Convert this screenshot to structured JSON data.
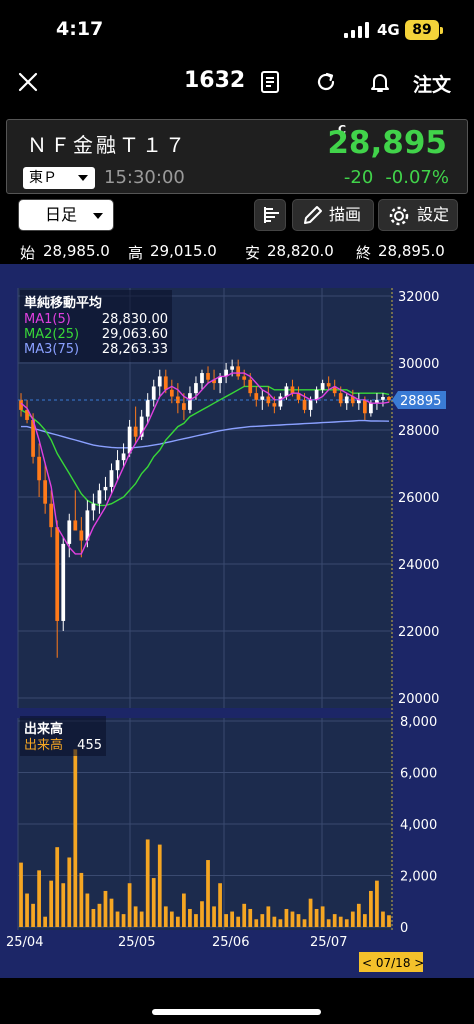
{
  "status": {
    "time": "4:17",
    "network": "4G",
    "battery": "89"
  },
  "nav": {
    "code": "1632",
    "order_label": "注文"
  },
  "quote": {
    "name": "ＮＦ金融Ｔ１７",
    "market": "東Ｐ",
    "time": "15:30:00",
    "flag": "C",
    "price": "28,895",
    "change": "-20",
    "change_pct": "-0.07%"
  },
  "toolbar": {
    "period": "日足",
    "draw": "描画",
    "settings": "設定"
  },
  "ohlc": {
    "open_label": "始",
    "open": "28,985.0",
    "high_label": "高",
    "high": "29,015.0",
    "low_label": "安",
    "low": "28,820.0",
    "close_label": "終",
    "close": "28,895.0"
  },
  "ma_legend": {
    "title": "単純移動平均",
    "rows": [
      {
        "label": "MA1(5)",
        "value": "28,830.00",
        "color": "#e040e0"
      },
      {
        "label": "MA2(25)",
        "value": "29,063.60",
        "color": "#38d838"
      },
      {
        "label": "MA3(75)",
        "value": "28,263.33",
        "color": "#8aa0ff"
      }
    ]
  },
  "volume_legend": {
    "title": "出来高",
    "label": "出来高",
    "value": "455"
  },
  "colors": {
    "up": "#ffffff",
    "down": "#ff7a1a",
    "bg": "#1c2667",
    "price_tag": "#3a7bd5",
    "volume": "#f5a623"
  },
  "chart_data": {
    "type": "candlestick",
    "price_axis": {
      "ticks": [
        "32000",
        "30000",
        "28000",
        "26000",
        "24000",
        "22000",
        "20000"
      ],
      "ylim": [
        20000,
        32000
      ]
    },
    "volume_axis": {
      "ticks": [
        "8,000",
        "6,000",
        "4,000",
        "2,000",
        "0"
      ],
      "ylim": [
        0,
        8000
      ]
    },
    "x_ticks": [
      "25/04",
      "25/05",
      "25/06",
      "25/07"
    ],
    "current_price_tag": "28895",
    "cursor_date": "< 07/18 >",
    "candles": [
      [
        28900,
        29100,
        28400,
        28600
      ],
      [
        28600,
        28900,
        28200,
        28300
      ],
      [
        28300,
        28500,
        27000,
        27200
      ],
      [
        27200,
        27600,
        26000,
        26500
      ],
      [
        26500,
        27000,
        25500,
        25800
      ],
      [
        25800,
        26200,
        24800,
        25100
      ],
      [
        25100,
        25300,
        21200,
        22300
      ],
      [
        22300,
        24800,
        22000,
        24600
      ],
      [
        24600,
        25500,
        24200,
        25300
      ],
      [
        25300,
        26200,
        25100,
        25000
      ],
      [
        25000,
        25400,
        24200,
        24700
      ],
      [
        24700,
        25900,
        24500,
        25600
      ],
      [
        25600,
        26100,
        25300,
        25800
      ],
      [
        25800,
        26400,
        25500,
        26200
      ],
      [
        26200,
        26600,
        25900,
        26300
      ],
      [
        26300,
        27000,
        26100,
        26800
      ],
      [
        26800,
        27400,
        26500,
        27100
      ],
      [
        27100,
        27600,
        26900,
        27300
      ],
      [
        27300,
        28300,
        27200,
        28100
      ],
      [
        28100,
        28700,
        27600,
        27800
      ],
      [
        27800,
        28600,
        27700,
        28400
      ],
      [
        28400,
        29100,
        28200,
        28900
      ],
      [
        28900,
        29500,
        28700,
        29300
      ],
      [
        29300,
        29800,
        29000,
        29600
      ],
      [
        29600,
        29800,
        29100,
        29200
      ],
      [
        29200,
        29500,
        28800,
        29000
      ],
      [
        29000,
        29400,
        28500,
        28800
      ],
      [
        28800,
        29100,
        28300,
        28600
      ],
      [
        28600,
        29300,
        28500,
        29100
      ],
      [
        29100,
        29600,
        28900,
        29400
      ],
      [
        29400,
        29800,
        29200,
        29700
      ],
      [
        29700,
        29900,
        29400,
        29500
      ],
      [
        29500,
        29800,
        29200,
        29400
      ],
      [
        29400,
        29700,
        29100,
        29600
      ],
      [
        29600,
        30000,
        29400,
        29800
      ],
      [
        29800,
        30100,
        29600,
        29900
      ],
      [
        29900,
        30100,
        29500,
        29600
      ],
      [
        29600,
        29800,
        29300,
        29500
      ],
      [
        29500,
        29700,
        29000,
        29100
      ],
      [
        29100,
        29300,
        28700,
        28900
      ],
      [
        28900,
        29200,
        28600,
        29000
      ],
      [
        29000,
        29300,
        28700,
        28800
      ],
      [
        28800,
        29000,
        28500,
        28700
      ],
      [
        28700,
        29100,
        28600,
        29000
      ],
      [
        29000,
        29400,
        28900,
        29300
      ],
      [
        29300,
        29500,
        29000,
        29100
      ],
      [
        29100,
        29300,
        28800,
        28900
      ],
      [
        28900,
        29100,
        28500,
        28600
      ],
      [
        28600,
        29000,
        28400,
        28900
      ],
      [
        28900,
        29300,
        28800,
        29200
      ],
      [
        29200,
        29500,
        29100,
        29400
      ],
      [
        29400,
        29600,
        29200,
        29300
      ],
      [
        29300,
        29500,
        29000,
        29100
      ],
      [
        29100,
        29300,
        28700,
        28800
      ],
      [
        28800,
        29100,
        28600,
        29000
      ],
      [
        29000,
        29200,
        28700,
        28800
      ],
      [
        28800,
        29100,
        28600,
        28900
      ],
      [
        28900,
        29000,
        28300,
        28500
      ],
      [
        28500,
        28900,
        28400,
        28800
      ],
      [
        28800,
        29100,
        28600,
        28900
      ],
      [
        28900,
        29100,
        28700,
        28985
      ],
      [
        28985,
        29015,
        28820,
        28895
      ]
    ],
    "ma1": [
      28800,
      28650,
      28300,
      27700,
      27000,
      26300,
      25100,
      24800,
      24500,
      24300,
      24300,
      24700,
      25100,
      25400,
      25700,
      26100,
      26500,
      26900,
      27300,
      27600,
      27900,
      28200,
      28600,
      29000,
      29200,
      29300,
      29200,
      29000,
      28900,
      29000,
      29200,
      29400,
      29500,
      29600,
      29600,
      29700,
      29700,
      29700,
      29600,
      29400,
      29200,
      29100,
      28900,
      28900,
      29000,
      29100,
      29100,
      29000,
      28900,
      28900,
      29000,
      29200,
      29300,
      29200,
      29100,
      29000,
      28900,
      28900,
      28800,
      28800,
      28800,
      28830
    ],
    "ma2": [
      28600,
      28500,
      28350,
      28200,
      28000,
      27700,
      27300,
      27000,
      26700,
      26400,
      26100,
      25900,
      25800,
      25750,
      25750,
      25800,
      25900,
      26000,
      26200,
      26400,
      26700,
      26900,
      27200,
      27400,
      27700,
      27900,
      28100,
      28200,
      28400,
      28500,
      28600,
      28700,
      28800,
      28900,
      29000,
      29100,
      29200,
      29300,
      29300,
      29300,
      29300,
      29300,
      29200,
      29200,
      29200,
      29200,
      29200,
      29200,
      29200,
      29200,
      29200,
      29200,
      29200,
      29200,
      29200,
      29100,
      29100,
      29100,
      29100,
      29100,
      29100,
      29063
    ],
    "ma3": [
      28100,
      28100,
      28050,
      28000,
      27950,
      27900,
      27850,
      27800,
      27750,
      27700,
      27650,
      27600,
      27550,
      27520,
      27500,
      27480,
      27470,
      27470,
      27470,
      27480,
      27500,
      27520,
      27550,
      27580,
      27620,
      27660,
      27700,
      27740,
      27780,
      27820,
      27860,
      27900,
      27940,
      27980,
      28010,
      28040,
      28060,
      28080,
      28100,
      28110,
      28120,
      28130,
      28140,
      28150,
      28160,
      28170,
      28180,
      28190,
      28200,
      28210,
      28220,
      28230,
      28240,
      28250,
      28260,
      28270,
      28280,
      28280,
      28270,
      28270,
      28265,
      28263
    ],
    "volume": [
      2500,
      1300,
      900,
      2200,
      400,
      1800,
      3100,
      1700,
      2700,
      6900,
      2100,
      1300,
      700,
      900,
      1400,
      1100,
      600,
      500,
      1700,
      800,
      600,
      3400,
      1900,
      3200,
      800,
      600,
      400,
      1300,
      700,
      500,
      1000,
      2600,
      800,
      1700,
      500,
      600,
      400,
      900,
      700,
      300,
      500,
      800,
      400,
      300,
      700,
      600,
      500,
      300,
      1100,
      700,
      800,
      300,
      500,
      400,
      300,
      600,
      900,
      500,
      1400,
      1800,
      600,
      455
    ]
  }
}
